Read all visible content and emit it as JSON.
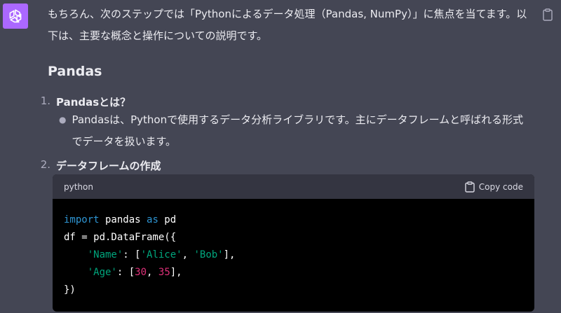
{
  "message": {
    "paragraph": "もちろん、次のステップでは「Pythonによるデータ処理（Pandas, NumPy）」に焦点を当てます。以下は、主要な概念と操作についての説明です。",
    "heading": "Pandas",
    "list": [
      {
        "num": "1.",
        "title": "Pandasとは？"
      },
      {
        "num": "2.",
        "title": "データフレームの作成"
      }
    ],
    "bullet": "Pandasは、Pythonで使用するデータ分析ライブラリです。主にデータフレームと呼ばれる形式でデータを扱います。"
  },
  "code": {
    "language": "python",
    "copy_label": "Copy code",
    "lines": {
      "l1_kw1": "import",
      "l1_mid": " pandas ",
      "l1_kw2": "as",
      "l1_end": " pd",
      "l2": "df = pd.DataFrame({",
      "l3_indent": "    ",
      "l3_key": "'Name'",
      "l3_mid": ": [",
      "l3_v1": "'Alice'",
      "l3_sep": ", ",
      "l3_v2": "'Bob'",
      "l3_end": "],",
      "l4_indent": "    ",
      "l4_key": "'Age'",
      "l4_mid": ": [",
      "l4_v1": "30",
      "l4_sep": ", ",
      "l4_v2": "35",
      "l4_end": "],",
      "l5": "})"
    }
  },
  "colors": {
    "assistant_avatar": "#ab68ff",
    "background": "#444654",
    "keyword": "#2e95d3",
    "string": "#00a67d",
    "number": "#df3079"
  },
  "icons": {
    "avatar": "openai-logo-icon",
    "copy": "clipboard-icon"
  }
}
